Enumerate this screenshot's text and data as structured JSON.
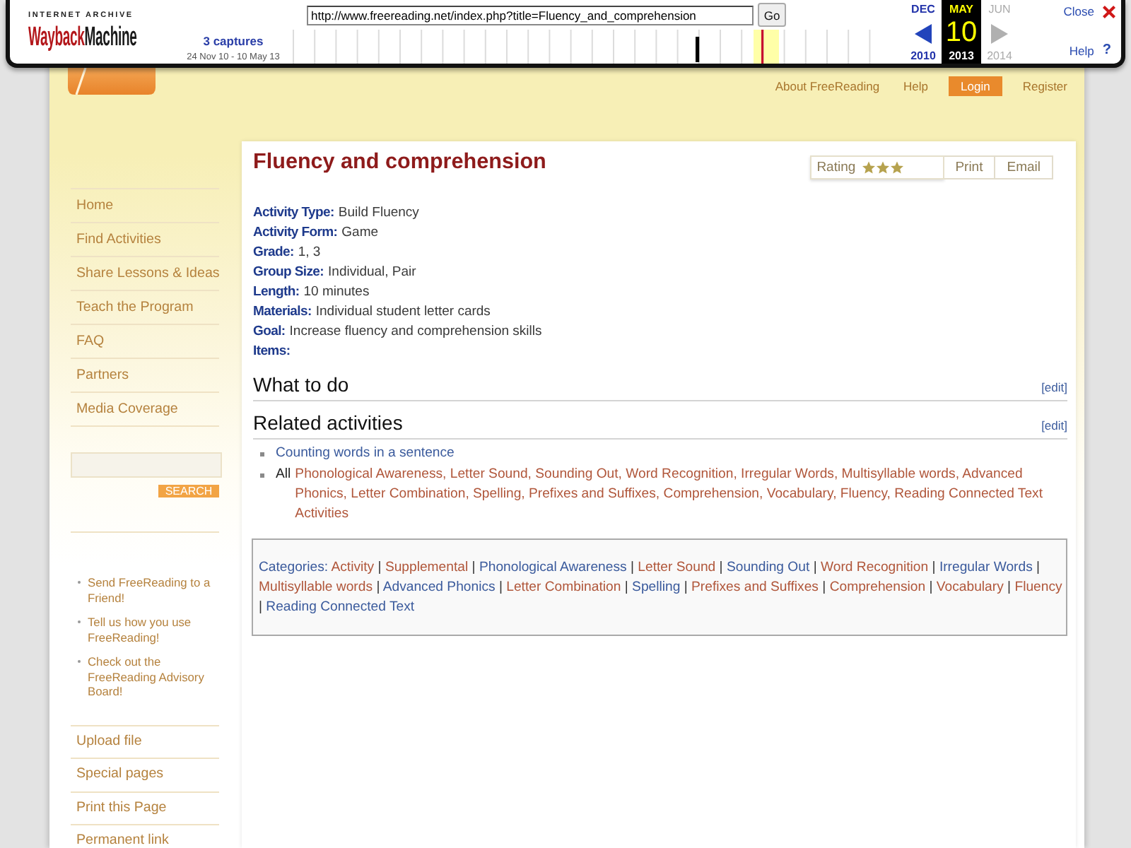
{
  "wayback": {
    "archive_label": "INTERNET ARCHIVE",
    "logo_primary": "Wayback",
    "logo_secondary": "Machine",
    "url": "http://www.freereading.net/index.php?title=Fluency_and_comprehension",
    "go_button": "Go",
    "captures_link": "3 captures",
    "capture_range": "24 Nov 10 - 10 May 13",
    "calendar": {
      "prev": {
        "month": "DEC",
        "year": "2010",
        "disabled": false
      },
      "current": {
        "month": "MAY",
        "day": "10",
        "year": "2013"
      },
      "next": {
        "month": "JUN",
        "year": "2014",
        "disabled": true
      }
    },
    "close": "Close",
    "help": "Help",
    "help_mark": "?"
  },
  "top_nav": [
    {
      "label": "About FreeReading",
      "kind": "link"
    },
    {
      "label": "Help",
      "kind": "link"
    },
    {
      "label": "Login",
      "kind": "button"
    },
    {
      "label": "Register",
      "kind": "link"
    }
  ],
  "sidebar": {
    "nav": [
      "Home",
      "Find Activities",
      "Share Lessons & Ideas",
      "Teach the Program",
      "FAQ",
      "Partners",
      "Media Coverage"
    ],
    "search_button": "SEARCH",
    "promo_links": [
      "Send FreeReading to a Friend!",
      "Tell us how you use FreeReading!",
      "Check out the FreeReading Advisory Board!"
    ],
    "tools": [
      "Upload file",
      "Special pages",
      "Print this Page",
      "Permanent link"
    ]
  },
  "article": {
    "title": "Fluency and comprehension",
    "rating": {
      "label": "Rating",
      "stars": 3
    },
    "actions": [
      "Print",
      "Email"
    ],
    "fields": [
      {
        "label": "Activity Type:",
        "value": "Build Fluency"
      },
      {
        "label": "Activity Form:",
        "value": "Game"
      },
      {
        "label": "Grade:",
        "value": "1, 3"
      },
      {
        "label": "Group Size:",
        "value": "Individual, Pair"
      },
      {
        "label": "Length:",
        "value": "10 minutes"
      },
      {
        "label": "Materials:",
        "value": "Individual student letter cards"
      },
      {
        "label": "Goal:",
        "value": "Increase fluency and comprehension skills"
      },
      {
        "label": "Items:"
      }
    ],
    "sections": [
      {
        "heading": "What to do",
        "edit": "[edit]"
      },
      {
        "heading": "Related activities",
        "edit": "[edit]",
        "items": [
          {
            "link": "Counting words in a sentence",
            "color": "#3a5a9c"
          },
          {
            "prefix": "All",
            "link": "Phonological Awareness, Letter Sound, Sounding Out, Word Recognition, Irregular Words, Multisyllable words, Advanced Phonics, Letter Combination, Spelling, Prefixes and Suffixes, Comprehension, Vocabulary, Fluency, Reading Connected Text Activities",
            "color": "#b0563a"
          }
        ]
      }
    ],
    "categories": {
      "label": "Categories:",
      "separator": "|",
      "links": [
        {
          "text": "Activity",
          "color": "#b0563a"
        },
        {
          "text": "Supplemental",
          "color": "#b0563a"
        },
        {
          "text": "Phonological Awareness",
          "color": "#3a5a9c"
        },
        {
          "text": "Letter Sound",
          "color": "#b0563a"
        },
        {
          "text": "Sounding Out",
          "color": "#3a5a9c"
        },
        {
          "text": "Word Recognition",
          "color": "#b0563a"
        },
        {
          "text": "Irregular Words",
          "color": "#3a5a9c"
        },
        {
          "text": "Multisyllable words",
          "color": "#b0563a"
        },
        {
          "text": "Advanced Phonics",
          "color": "#3a5a9c"
        },
        {
          "text": "Letter Combination",
          "color": "#b0563a"
        },
        {
          "text": "Spelling",
          "color": "#3a5a9c"
        },
        {
          "text": "Prefixes and Suffixes",
          "color": "#b0563a"
        },
        {
          "text": "Comprehension",
          "color": "#b0563a"
        },
        {
          "text": "Vocabulary",
          "color": "#b0563a"
        },
        {
          "text": "Fluency",
          "color": "#b0563a"
        },
        {
          "text": "Reading Connected Text",
          "color": "#3a5a9c"
        }
      ]
    }
  }
}
